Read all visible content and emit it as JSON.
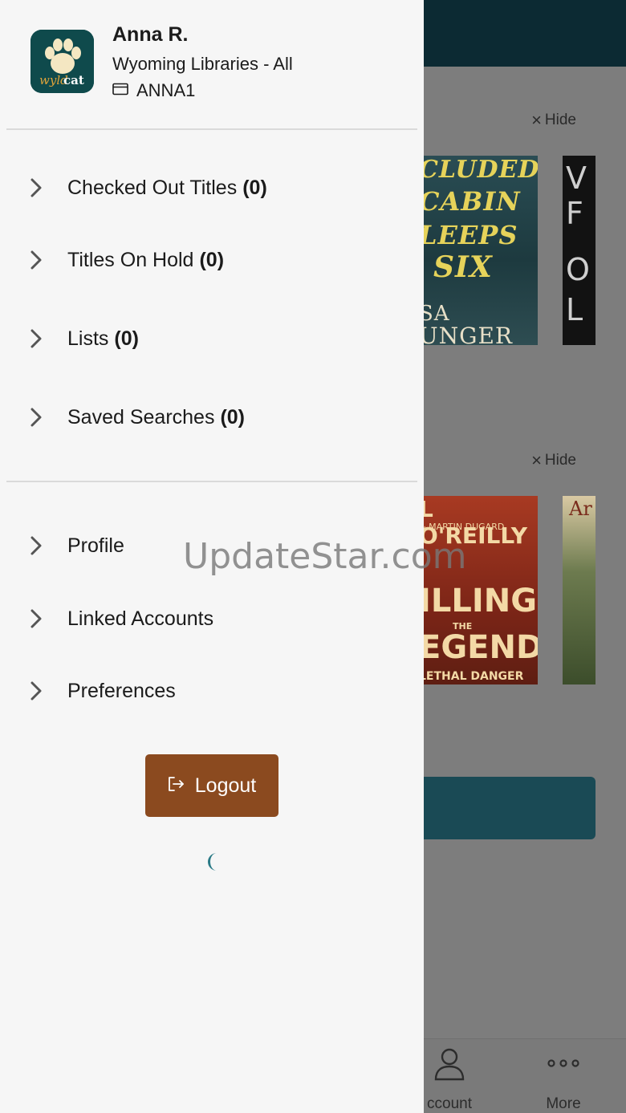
{
  "drawer": {
    "user_name": "Anna R.",
    "library_name": "Wyoming Libraries - All",
    "card_number": "ANNA1",
    "logo_text_left": "wyld",
    "logo_text_right": "cat",
    "section1": [
      {
        "label": "Checked Out Titles",
        "count": "(0)"
      },
      {
        "label": "Titles On Hold",
        "count": "(0)"
      },
      {
        "label": "Lists",
        "count": "(0)"
      },
      {
        "label": "Saved Searches",
        "count": "(0)"
      }
    ],
    "section2": [
      {
        "label": "Profile"
      },
      {
        "label": "Linked Accounts"
      },
      {
        "label": "Preferences"
      }
    ],
    "logout_label": "Logout"
  },
  "background": {
    "hide_label": "Hide",
    "covers": {
      "cover1_lines": [
        "CLUDED",
        "CABIN",
        "LEEPS",
        "SIX",
        "SA",
        "UNGER"
      ],
      "cover2_lines": [
        "V",
        "F",
        "O",
        "L"
      ],
      "cover3_lines": [
        "L O'REILLY",
        "& MARTIN DUGARD",
        "ILLING",
        "THE",
        "EGENDS",
        "LETHAL DANGER"
      ],
      "cover4_lines": [
        "Ar"
      ]
    },
    "tabbar": {
      "account_label": "ccount",
      "more_label": "More"
    }
  },
  "watermark": "UpdateStar.com",
  "colors": {
    "logout_bg": "#8b4a1f",
    "logo_bg": "#0f4a4c",
    "spinner": "#2a7a86",
    "topbar_bg": "#0c2a33"
  }
}
